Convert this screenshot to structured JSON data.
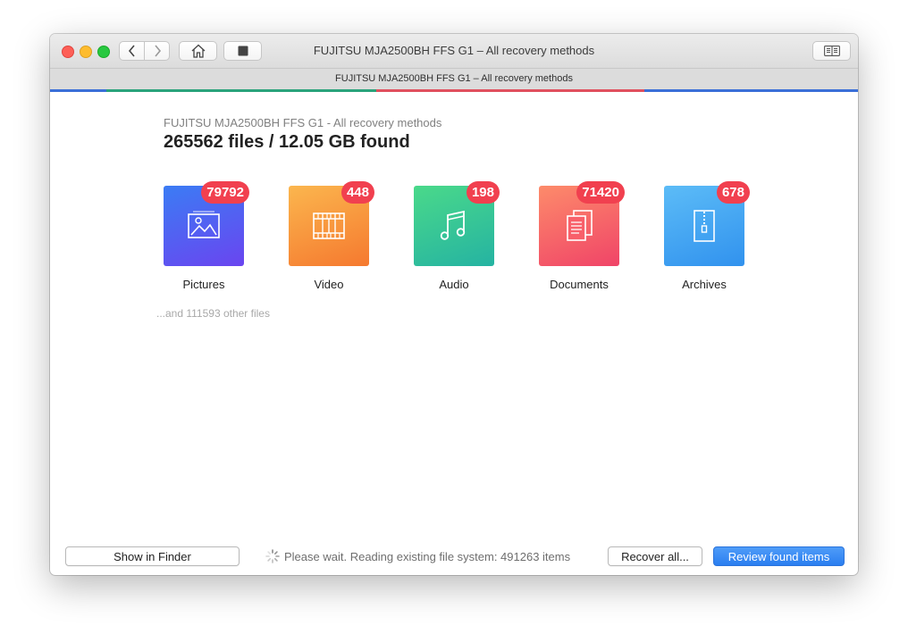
{
  "window": {
    "title": "FUJITSU MJA2500BH FFS G1 – All recovery methods",
    "tab_title": "FUJITSU MJA2500BH FFS G1 – All recovery methods"
  },
  "toolbar": {
    "back_icon": "chevron-left-icon",
    "forward_icon": "chevron-right-icon",
    "home_icon": "home-icon",
    "stop_icon": "stop-icon",
    "sidebar_icon": "book-icon"
  },
  "progress_colors": [
    "#3a6fd8",
    "#2aa37b",
    "#e0505e",
    "#3a6fd8"
  ],
  "main": {
    "drive_label": "FUJITSU MJA2500BH FFS G1 - All recovery methods",
    "found_heading": "265562 files / 12.05 GB found",
    "categories": [
      {
        "label": "Pictures",
        "count": "79792",
        "icon": "picture-icon",
        "colors": [
          "#3b7cf4",
          "#6a45f0"
        ]
      },
      {
        "label": "Video",
        "count": "448",
        "icon": "film-icon",
        "colors": [
          "#fbb64e",
          "#f5792f"
        ]
      },
      {
        "label": "Audio",
        "count": "198",
        "icon": "music-note-icon",
        "colors": [
          "#4ad98a",
          "#25b3a2"
        ]
      },
      {
        "label": "Documents",
        "count": "71420",
        "icon": "documents-icon",
        "colors": [
          "#fd8b6a",
          "#f04468"
        ]
      },
      {
        "label": "Archives",
        "count": "678",
        "icon": "archive-zip-icon",
        "colors": [
          "#5cbcf7",
          "#3192ee"
        ]
      }
    ],
    "other_files": "...and 111593 other files"
  },
  "footer": {
    "show_in_finder": "Show in Finder",
    "status_text": "Please wait. Reading existing file system: 491263 items",
    "recover_all": "Recover all...",
    "review": "Review found items"
  }
}
